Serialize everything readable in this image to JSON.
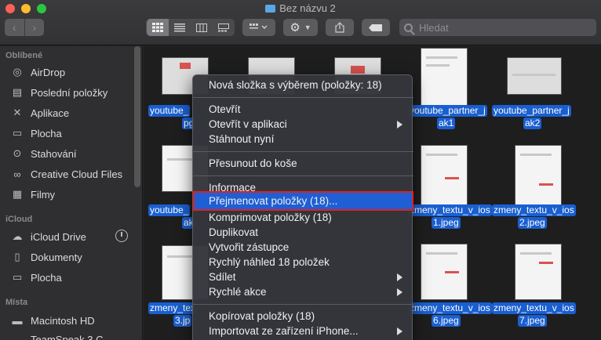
{
  "window": {
    "title": "Bez názvu 2",
    "search_placeholder": "Hledat"
  },
  "sidebar": {
    "favorites_header": "Oblíbené",
    "favorites": [
      {
        "label": "AirDrop",
        "icon": "airdrop-icon"
      },
      {
        "label": "Poslední položky",
        "icon": "recents-icon"
      },
      {
        "label": "Aplikace",
        "icon": "applications-icon"
      },
      {
        "label": "Plocha",
        "icon": "desktop-icon"
      },
      {
        "label": "Stahování",
        "icon": "downloads-icon"
      },
      {
        "label": "Creative Cloud Files",
        "icon": "creative-cloud-icon"
      },
      {
        "label": "Filmy",
        "icon": "movies-icon"
      }
    ],
    "icloud_header": "iCloud",
    "icloud": [
      {
        "label": "iCloud Drive",
        "icon": "cloud-icon"
      },
      {
        "label": "Dokumenty",
        "icon": "document-icon"
      },
      {
        "label": "Plocha",
        "icon": "desktop-icon"
      }
    ],
    "places_header": "Místa",
    "places": [
      {
        "label": "Macintosh HD",
        "icon": "disk-icon"
      },
      {
        "label": "TeamSpeak 3 C",
        "icon": "disk-icon"
      }
    ]
  },
  "files": {
    "row1": [
      "youtube_",
      "pg",
      "youtube_partner_j",
      "ak1",
      "youtube_partner_j",
      "ak2"
    ],
    "row2": [
      "youtube_",
      "ak",
      "zmeny_textu_v_ios",
      "1.jpeg",
      "zmeny_textu_v_ios",
      "2.jpeg"
    ],
    "row3": [
      "zmeny_tex",
      "3.jp",
      "zmeny_textu_v_ios",
      "6.jpeg",
      "zmeny_textu_v_ios",
      "7.jpeg"
    ]
  },
  "menu": {
    "items": [
      "Nová složka s výběrem (položky: 18)",
      "Otevřít",
      "Otevřít v aplikaci",
      "Stáhnout nyní",
      "Přesunout do koše",
      "Informace",
      "Přejmenovat položky (18)...",
      "Komprimovat položky (18)",
      "Duplikovat",
      "Vytvořit zástupce",
      "Rychlý náhled 18 položek",
      "Sdílet",
      "Rychlé akce",
      "Kopírovat položky (18)",
      "Importovat ze zařízení iPhone..."
    ]
  },
  "colors": {
    "accent": "#1f5fd3",
    "highlight_border": "#e01f26"
  }
}
